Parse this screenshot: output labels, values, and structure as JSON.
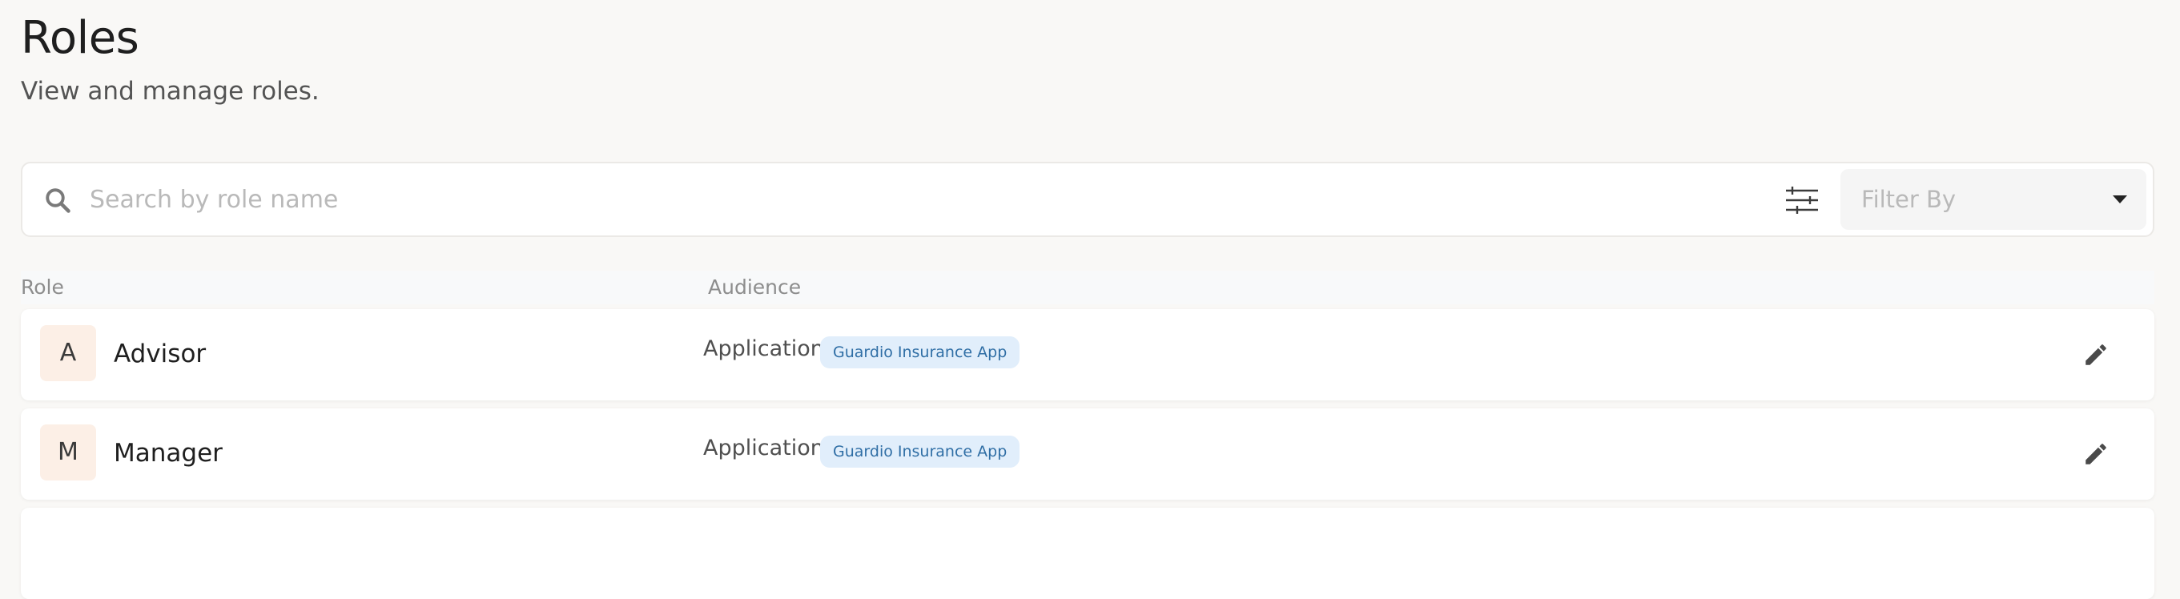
{
  "header": {
    "title": "Roles",
    "subtitle": "View and manage roles."
  },
  "search": {
    "placeholder": "Search by role name",
    "value": ""
  },
  "filter": {
    "label": "Filter By"
  },
  "table": {
    "columns": [
      "Role",
      "Audience"
    ],
    "rows": [
      {
        "initial": "A",
        "name": "Advisor",
        "audience_type": "Application",
        "audience_app": "Guardio Insurance App"
      },
      {
        "initial": "M",
        "name": "Manager",
        "audience_type": "Application",
        "audience_app": "Guardio Insurance App"
      }
    ]
  },
  "icons": {
    "search": "search-icon",
    "filter_settings": "sliders-icon",
    "dropdown": "caret-down-icon",
    "edit": "pencil-icon"
  },
  "colors": {
    "background": "#f9f8f6",
    "avatar_bg": "#fcefe6",
    "badge_bg": "#e1eefb",
    "badge_text": "#2f6ea5"
  }
}
